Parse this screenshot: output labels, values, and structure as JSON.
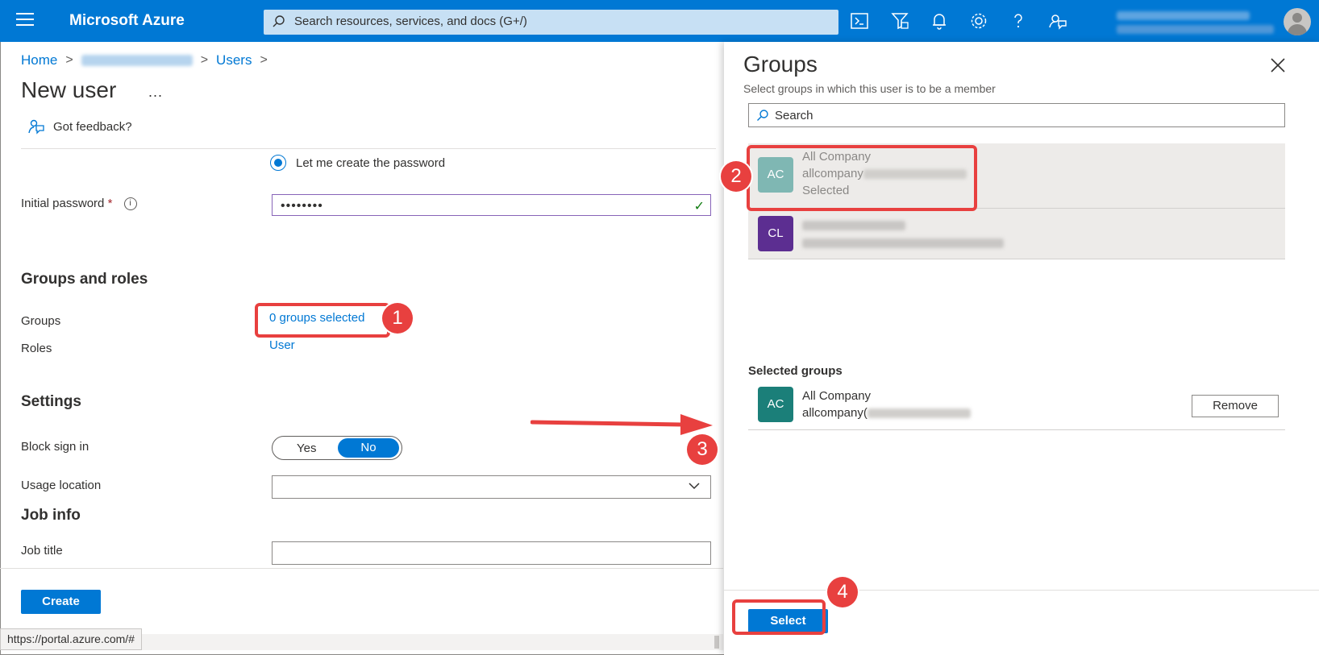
{
  "topbar": {
    "brand": "Microsoft Azure",
    "search_placeholder": "Search resources, services, and docs (G+/)",
    "icons": [
      "cloud-shell-icon",
      "directory-filter-icon",
      "notifications-icon",
      "settings-icon",
      "help-icon",
      "feedback-icon"
    ]
  },
  "breadcrumb": {
    "home": "Home",
    "users": "Users"
  },
  "page": {
    "title": "New user",
    "more": "...",
    "feedback": "Got feedback?"
  },
  "password": {
    "radio_label": "Let me create the password",
    "label": "Initial password",
    "required_mark": "*",
    "info": "i",
    "masked_value": "••••••••",
    "check": "✓"
  },
  "groups_roles": {
    "heading": "Groups and roles",
    "groups_label": "Groups",
    "groups_link": "0 groups selected",
    "roles_label": "Roles",
    "roles_link": "User"
  },
  "settings": {
    "heading": "Settings",
    "block_label": "Block sign in",
    "yes": "Yes",
    "no": "No",
    "usage_label": "Usage location"
  },
  "job": {
    "heading": "Job info",
    "title_label": "Job title"
  },
  "footer": {
    "create": "Create",
    "status_url": "https://portal.azure.com/#"
  },
  "panel": {
    "title": "Groups",
    "subtitle": "Select groups in which this user is to be a member",
    "search_placeholder": "Search",
    "groups": [
      {
        "initials": "AC",
        "name": "All Company",
        "mail_prefix": "allcompany",
        "state": "Selected",
        "color": "#7fb7b3"
      },
      {
        "initials": "CL",
        "color": "#5c2e91"
      }
    ],
    "selected_heading": "Selected groups",
    "selected": [
      {
        "initials": "AC",
        "name": "All Company",
        "mail_prefix": "allcompany(",
        "color": "#1b7f79"
      }
    ],
    "remove": "Remove",
    "select": "Select"
  },
  "annotations": {
    "steps": [
      "1",
      "2",
      "3",
      "4"
    ],
    "color": "#e8403f"
  }
}
